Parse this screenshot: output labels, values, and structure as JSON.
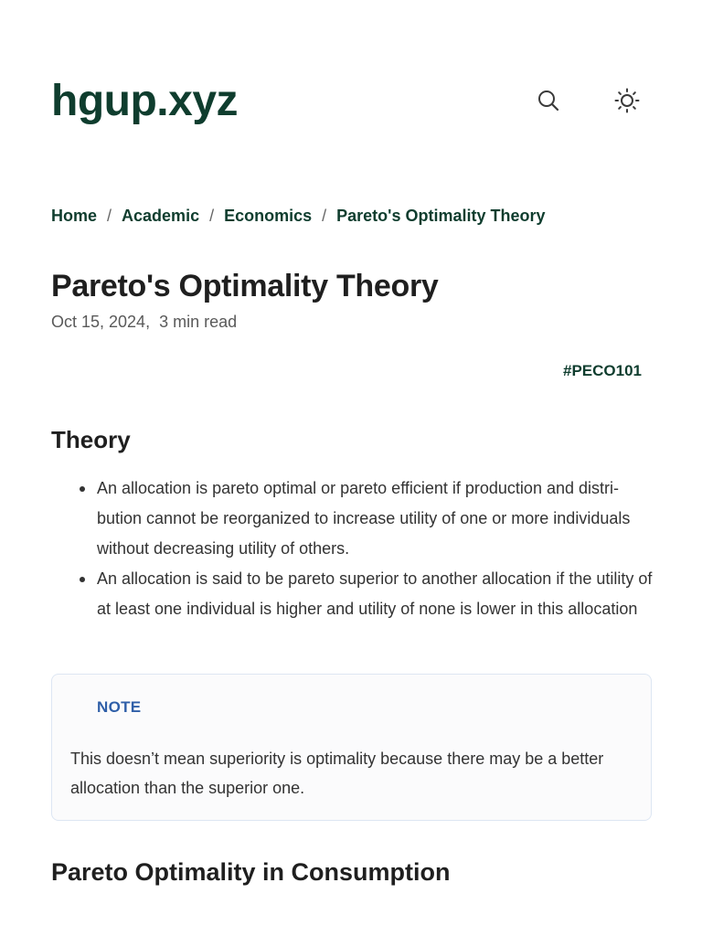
{
  "site": {
    "title": "hgup.xyz"
  },
  "header": {
    "icons": [
      "search-icon",
      "sun-icon"
    ]
  },
  "breadcrumb": {
    "items": [
      "Home",
      "Academic",
      "Economics",
      "Pareto's Optimality Theory"
    ],
    "separator": "/"
  },
  "post": {
    "title": "Pareto's Optimality Theory",
    "date": "Oct 15, 2024",
    "read_time": "3 min read",
    "tag": "#PECO101"
  },
  "content": {
    "theory_heading": "Theory",
    "bullets": [
      "An allocation is pareto optimal or pareto efficient if production and distri­bution cannot be reorganized to increase utility of one or more individu­als without decreasing utility of others.",
      "An allocation is said to be pareto superior to another allocation if the util­ity of at least one individual is higher and utility of none is lower in this allocation"
    ],
    "note": {
      "label": "NOTE",
      "text": "This doesn’t mean superiority is optimality because there may be a better allocation than the superior one."
    },
    "next_heading": "Pareto Optimality in Consumption"
  },
  "colors": {
    "brand": "#0f3d2e",
    "note_label": "#2f5fa8",
    "note_border": "#dde6f3"
  }
}
